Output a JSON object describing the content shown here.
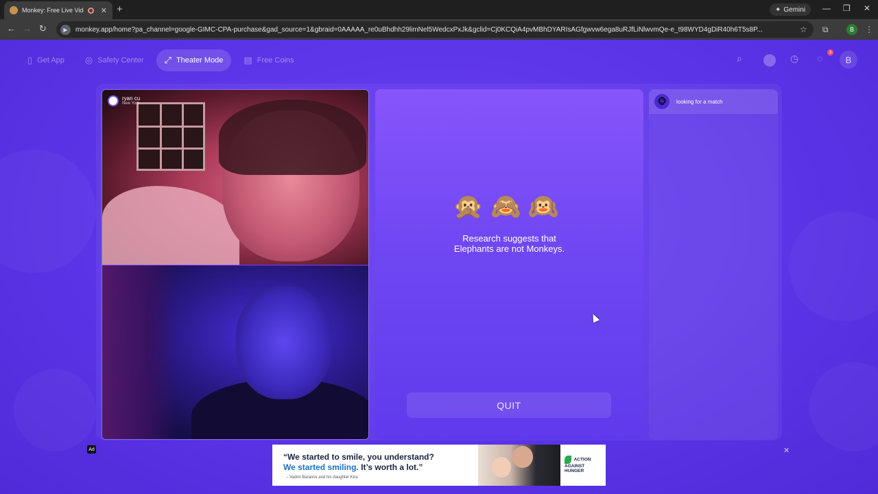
{
  "browser": {
    "tab_title": "Monkey: Free Live Video Ch",
    "tab_close": "✕",
    "new_tab": "+",
    "gemini_label": "Gemini",
    "url": "monkey.app/home?pa_channel=google-GIMC-CPA-purchase&gad_source=1&gbraid=0AAAAA_re0uBhdhh29limNel5WedcxPxJk&gclid=Cj0KCQiA4pvMBhDYARIsAGfgwvw6ega8uRJfLiNlwvmQe-e_t98WYD4gDiR40h6T5s8P...",
    "profile_initial": "B"
  },
  "nav": {
    "items": [
      {
        "label": "Get App",
        "icon": "phone-icon",
        "glyph": "▯"
      },
      {
        "label": "Safety Center",
        "icon": "shield-icon",
        "glyph": "◎"
      },
      {
        "label": "Theater Mode",
        "icon": "expand-icon",
        "glyph": "⤢",
        "active": true
      },
      {
        "label": "Free Coins",
        "icon": "coins-icon",
        "glyph": "▤"
      }
    ],
    "notification_count": "3",
    "user_initial": "B"
  },
  "video": {
    "peer_name": "ryan cu",
    "peer_location": "New York"
  },
  "center": {
    "monkeys": "🙊🙈🙉",
    "research_line1": "Research suggests that",
    "research_line2": "Elephants are not Monkeys.",
    "quit_label": "QUIT"
  },
  "chat": {
    "status": "looking for a match",
    "avatar_glyph": "🐵"
  },
  "ad": {
    "label": "Ad",
    "quote_line1": "“We started to smile, you understand?",
    "quote_line2_highlight": "We started smiling.",
    "quote_line2_rest": " It’s worth a lot.”",
    "attribution": "– Vadim Baranov and his daughter Kira",
    "brand_line1": "ACTION",
    "brand_line2": "AGAINST",
    "brand_line3": "HUNGER",
    "close": "✕"
  }
}
